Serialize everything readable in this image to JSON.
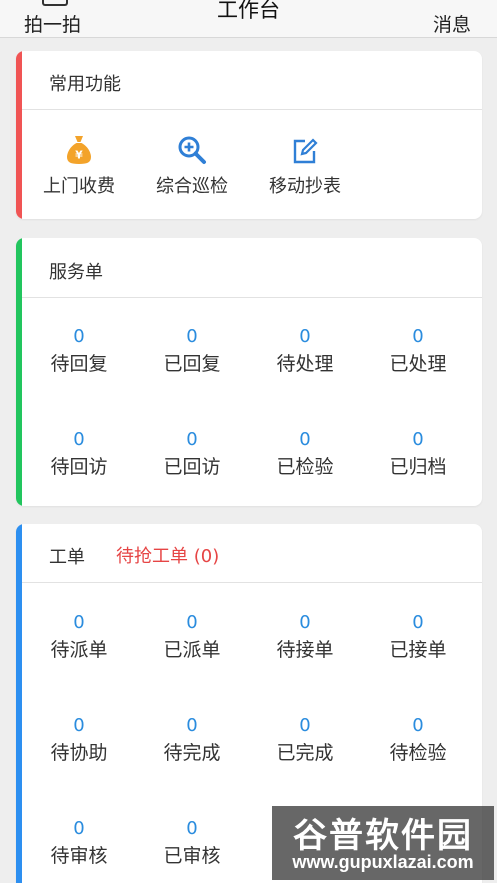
{
  "header": {
    "left_label": "拍一拍",
    "title": "工作台",
    "right_label": "消息"
  },
  "common": {
    "title": "常用功能",
    "accent": "#f05454",
    "items": [
      {
        "label": "上门收费",
        "icon": "money-bag-icon",
        "color": "#f3a32a"
      },
      {
        "label": "综合巡检",
        "icon": "zoom-in-icon",
        "color": "#2f7fd6"
      },
      {
        "label": "移动抄表",
        "icon": "edit-icon",
        "color": "#2f7fd6"
      }
    ]
  },
  "service": {
    "title": "服务单",
    "accent": "#22c55e",
    "stats": [
      {
        "value": "0",
        "label": "待回复"
      },
      {
        "value": "0",
        "label": "已回复"
      },
      {
        "value": "0",
        "label": "待处理"
      },
      {
        "value": "0",
        "label": "已处理"
      },
      {
        "value": "0",
        "label": "待回访"
      },
      {
        "value": "0",
        "label": "已回访"
      },
      {
        "value": "0",
        "label": "已检验"
      },
      {
        "value": "0",
        "label": "已归档"
      }
    ]
  },
  "workorder": {
    "title": "工单",
    "pending": "待抢工单 (0)",
    "accent": "#2d8ff0",
    "stats": [
      {
        "value": "0",
        "label": "待派单"
      },
      {
        "value": "0",
        "label": "已派单"
      },
      {
        "value": "0",
        "label": "待接单"
      },
      {
        "value": "0",
        "label": "已接单"
      },
      {
        "value": "0",
        "label": "待协助"
      },
      {
        "value": "0",
        "label": "待完成"
      },
      {
        "value": "0",
        "label": "已完成"
      },
      {
        "value": "0",
        "label": "待检验"
      },
      {
        "value": "0",
        "label": "待审核"
      },
      {
        "value": "0",
        "label": "已审核"
      }
    ]
  },
  "watermark": {
    "main": "谷普软件园",
    "url": "www.gupuxlazai.com"
  }
}
